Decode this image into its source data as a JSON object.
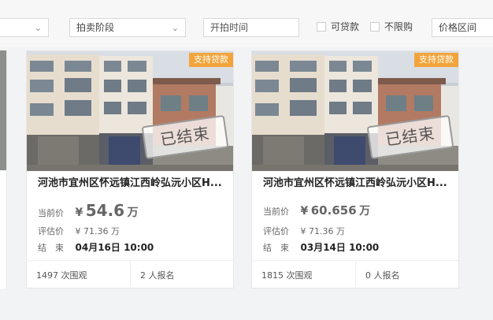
{
  "filters": {
    "stage_label": "拍卖阶段",
    "start_time_placeholder": "开拍时间",
    "loanable_label": "可贷款",
    "no_restriction_label": "不限购",
    "price_range_label": "价格区间"
  },
  "cards": [
    {
      "badge": "支持贷款",
      "stamp": "已结束",
      "title": "河池市宜州区怀远镇江西岭弘沅小区H...",
      "current_price_label": "当前价",
      "current_price_symbol": "¥",
      "current_price_value": "54.6",
      "current_price_unit": "万",
      "appraisal_label": "评估价",
      "appraisal_value": "¥ 71.36 万",
      "end_label": "结　束",
      "end_value": "04月16日 10:00",
      "views": "1497 次围观",
      "signups": "2 人报名"
    },
    {
      "badge": "支持贷款",
      "stamp": "已结束",
      "title": "河池市宜州区怀远镇江西岭弘沅小区H...",
      "current_price_label": "当前价",
      "current_price_symbol": "¥",
      "current_price_value": "60.656",
      "current_price_unit": "万",
      "appraisal_label": "评估价",
      "appraisal_value": "¥ 71.36 万",
      "end_label": "结　束",
      "end_value": "03月14日 10:00",
      "views": "1815 次围观",
      "signups": "0 人报名"
    }
  ]
}
